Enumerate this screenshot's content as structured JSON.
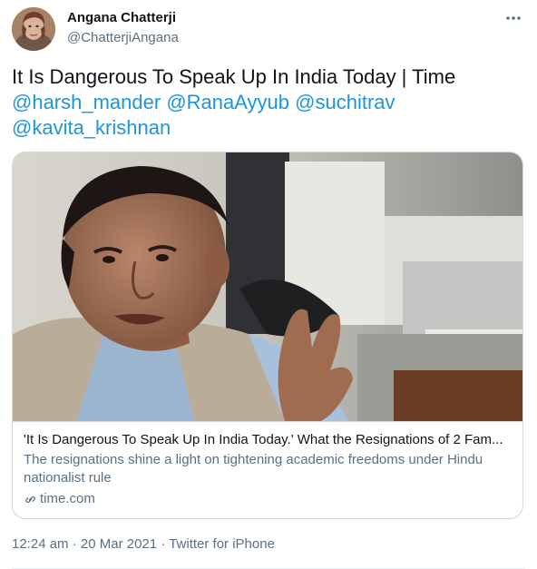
{
  "author": {
    "name": "Angana Chatterji",
    "handle": "@ChatterjiAngana"
  },
  "more_icon": "more-horizontal-icon",
  "tweet": {
    "line1": "It Is Dangerous To Speak Up In India Today | Time",
    "mentions": [
      "@harsh_mander",
      "@RanaAyyub",
      "@suchitrav",
      "@kavita_krishnan"
    ]
  },
  "card": {
    "title": "'It Is Dangerous To Speak Up In India Today.' What the Resignations of 2 Fam...",
    "description": "The resignations shine a light on tightening academic freedoms under Hindu nationalist rule",
    "domain": "time.com",
    "domain_icon": "link-icon"
  },
  "meta": {
    "time": "12:24 am",
    "separator": "·",
    "date": "20 Mar 2021",
    "source": "Twitter for iPhone"
  },
  "colors": {
    "link": "#1b95e0",
    "secondary": "#5b7083",
    "border": "#cfd9de"
  }
}
